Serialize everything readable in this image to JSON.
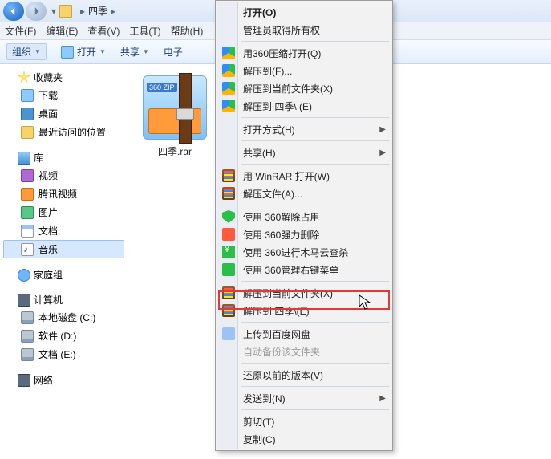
{
  "titlebar": {
    "path_label": "四季"
  },
  "menubar": {
    "file": "文件(F)",
    "edit": "编辑(E)",
    "view": "查看(V)",
    "tools": "工具(T)",
    "help": "帮助(H)"
  },
  "toolbar": {
    "organize": "组织",
    "open": "打开",
    "share": "共享",
    "email": "电子"
  },
  "sidebar": {
    "favorites": {
      "label": "收藏夹",
      "downloads": "下载",
      "desktop": "桌面",
      "recent": "最近访问的位置"
    },
    "libraries": {
      "label": "库",
      "videos": "视频",
      "tencent": "腾讯视频",
      "pictures": "图片",
      "documents": "文档",
      "music": "音乐"
    },
    "homegroup": {
      "label": "家庭组"
    },
    "computer": {
      "label": "计算机",
      "drive_c": "本地磁盘 (C:)",
      "drive_d": "软件 (D:)",
      "drive_e": "文档 (E:)"
    },
    "network": {
      "label": "网络"
    }
  },
  "content": {
    "file1_name": "四季.rar",
    "thumb_badge": "360\nZIP"
  },
  "ctx": {
    "open": "打开(O)",
    "run_as_admin": "管理员取得所有权",
    "open_360zip": "用360压缩打开(Q)",
    "extract_to": "解压到(F)...",
    "extract_here": "解压到当前文件夹(X)",
    "extract_to_folder": "解压到 四季\\ (E)",
    "open_with": "打开方式(H)",
    "share": "共享(H)",
    "open_winrar": "用 WinRAR 打开(W)",
    "extract_files": "解压文件(A)...",
    "unlock360": "使用 360解除占用",
    "forcedel360": "使用 360强力删除",
    "scan360": "使用 360进行木马云查杀",
    "menu360": "使用 360管理右键菜单",
    "extract_here2": "解压到当前文件夹(X)",
    "extract_to_folder2": "解压到 四季\\(E)",
    "upload_baidu": "上传到百度网盘",
    "auto_backup": "自动备份该文件夹",
    "prev_versions": "还原以前的版本(V)",
    "send_to": "发送到(N)",
    "cut": "剪切(T)",
    "copy": "复制(C)"
  }
}
